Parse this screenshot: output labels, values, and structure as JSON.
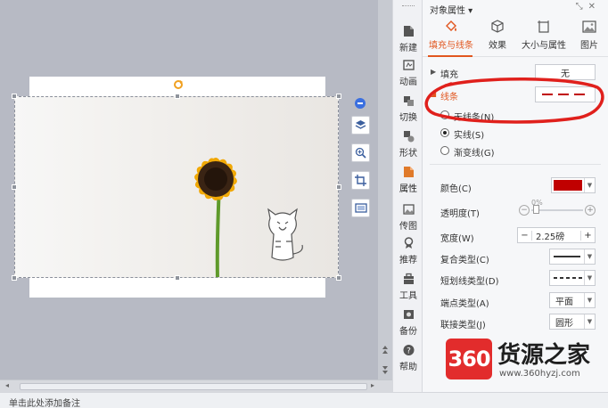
{
  "canvas": {
    "note_placeholder": "单击此处添加备注"
  },
  "toolstrip": {
    "items": [
      {
        "label": "新建",
        "icon": "new-icon"
      },
      {
        "label": "动画",
        "icon": "animation-icon"
      },
      {
        "label": "切换",
        "icon": "transition-icon"
      },
      {
        "label": "形状",
        "icon": "shape-icon"
      },
      {
        "label": "属性",
        "icon": "properties-icon"
      },
      {
        "label": "传图",
        "icon": "upload-image-icon"
      },
      {
        "label": "推荐",
        "icon": "recommend-icon"
      },
      {
        "label": "工具",
        "icon": "tools-icon"
      },
      {
        "label": "备份",
        "icon": "backup-icon"
      },
      {
        "label": "帮助",
        "icon": "help-icon"
      }
    ]
  },
  "panel": {
    "title": "对象属性 ▾",
    "tabs": [
      {
        "label": "填充与线条",
        "icon": "fill-bucket-icon"
      },
      {
        "label": "效果",
        "icon": "cube-icon"
      },
      {
        "label": "大小与属性",
        "icon": "size-icon"
      },
      {
        "label": "图片",
        "icon": "picture-icon"
      }
    ],
    "fill": {
      "label": "填充",
      "value": "无"
    },
    "line": {
      "label": "线条",
      "options": [
        "无线条(N)",
        "实线(S)",
        "渐变线(G)"
      ],
      "selected": "实线(S)",
      "color_label": "颜色(C)",
      "color_value": "#c00000",
      "transparency_label": "透明度(T)",
      "transparency_value": "0%",
      "width_label": "宽度(W)",
      "width_value": "2.25磅",
      "compound_label": "复合类型(C)",
      "dash_label": "短划线类型(D)",
      "cap_label": "端点类型(A)",
      "cap_value": "平面",
      "join_label": "联接类型(J)",
      "join_value": "圆形",
      "minus": "−",
      "plus": "+"
    }
  },
  "watermark": {
    "badge": "360",
    "name": "货源之家",
    "url": "www.360hyzj.com"
  },
  "colors": {
    "accent": "#e1561f",
    "line_color": "#c00000",
    "annotation_circle": "#e0201c",
    "watermark_red": "#e22c2c"
  }
}
